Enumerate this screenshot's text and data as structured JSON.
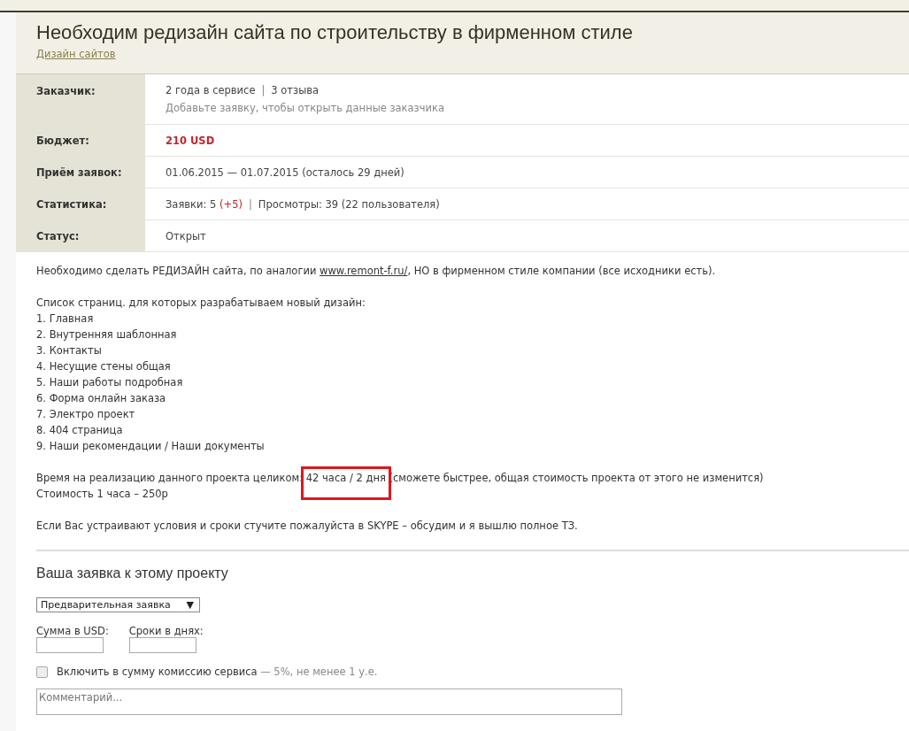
{
  "project": {
    "title": "Необходим редизайн сайта по строительству в фирменном стиле",
    "category": "Дизайн сайтов"
  },
  "details": [
    {
      "label": "Заказчик:",
      "kind": "customer",
      "lines": [
        "2 года в сервисе",
        "3 отзыва"
      ],
      "separator": "|",
      "note": "Добавьте заявку, чтобы открыть данные заказчика"
    },
    {
      "label": "Бюджет:",
      "kind": "budget",
      "value": "210 USD"
    },
    {
      "label": "Приём заявок:",
      "kind": "plain",
      "value": "01.06.2015 — 01.07.2015 (осталось 29 дней)"
    },
    {
      "label": "Статистика:",
      "kind": "stats",
      "bids": "Заявки: 5",
      "bids_delta": "(+5)",
      "separator": "|",
      "views": "Просмотры: 39 (22 пользователя)"
    },
    {
      "label": "Статус:",
      "kind": "plain",
      "value": "Открыт"
    }
  ],
  "description": {
    "intro_before": "Необходимо сделать РЕДИЗАЙН сайта, по аналогии",
    "link": "www.remont-f.ru/",
    "intro_after": ", НО в фирменном стиле компании (все исходники есть).",
    "list_title": "Список страниц. для которых разрабатываем новый дизайн:",
    "pages": [
      "1. Главная",
      "2. Внутренняя шаблонная",
      "3. Контакты",
      "4. Несущие стены общая",
      "5. Наши работы подробная",
      "6. Форма онлайн заказа",
      "7. Электро проект",
      "8. 404 страница",
      "9. Наши рекомендации / Наши документы"
    ],
    "time_parts": [
      "Время на реализацию данного проекта целиком: ",
      "42 часа / 2 дня",
      " (сможете быстрее, общая стоимость проекта от этого не изменится)"
    ],
    "time_highlighted": true,
    "rate": "Стоимость 1 часа – 250р",
    "contact": "Если Вас устраивают условия и сроки стучите пожалуйста в SKYPE – обсудим и я вышлю полное ТЗ."
  },
  "bid_form": {
    "heading": "Ваша заявка к этому проекту",
    "type_select": "Предварительная заявка",
    "select_arrow": "▼",
    "amount_label": "Сумма в USD:",
    "days_label": "Сроки в днях:",
    "commission": {
      "label": "Включить в сумму комиссию сервиса",
      "note": "— 5%, не менее 1 у.е.",
      "checked": false
    },
    "comment_placeholder": "Комментарий..."
  }
}
